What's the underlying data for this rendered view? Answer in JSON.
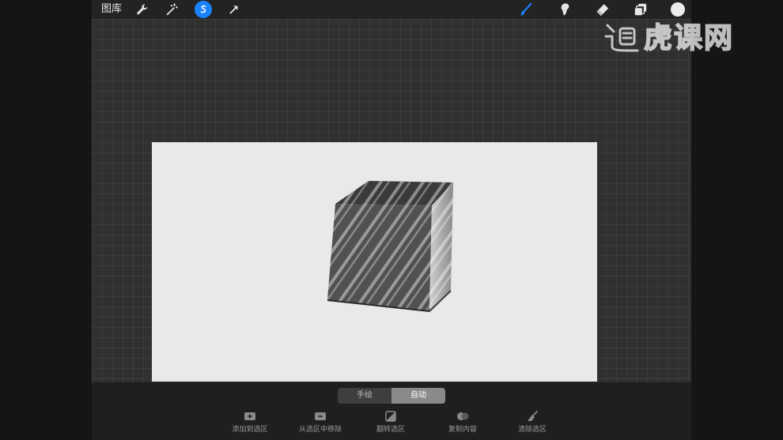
{
  "toolbar": {
    "gallery_label": "图库",
    "left_tools": [
      "wrench-icon",
      "magic-wand-icon",
      "selection-icon",
      "transform-arrow-icon"
    ],
    "active_tool": "selection-icon",
    "right_tools": [
      "brush-icon",
      "smudge-icon",
      "eraser-icon",
      "layers-icon"
    ],
    "current_color": "#ececec",
    "accent_color": "#1a84ff"
  },
  "selection_mode": {
    "options": [
      "手绘",
      "自动"
    ],
    "selected": "自动"
  },
  "actions": [
    {
      "label": "添加到选区",
      "icon": "add-selection-icon"
    },
    {
      "label": "从选区中移除",
      "icon": "remove-selection-icon"
    },
    {
      "label": "翻转选区",
      "icon": "invert-selection-icon"
    },
    {
      "label": "复制内容",
      "icon": "copy-content-icon"
    },
    {
      "label": "清除选区",
      "icon": "clear-selection-icon"
    }
  ],
  "watermark": {
    "text": "虎课网"
  }
}
